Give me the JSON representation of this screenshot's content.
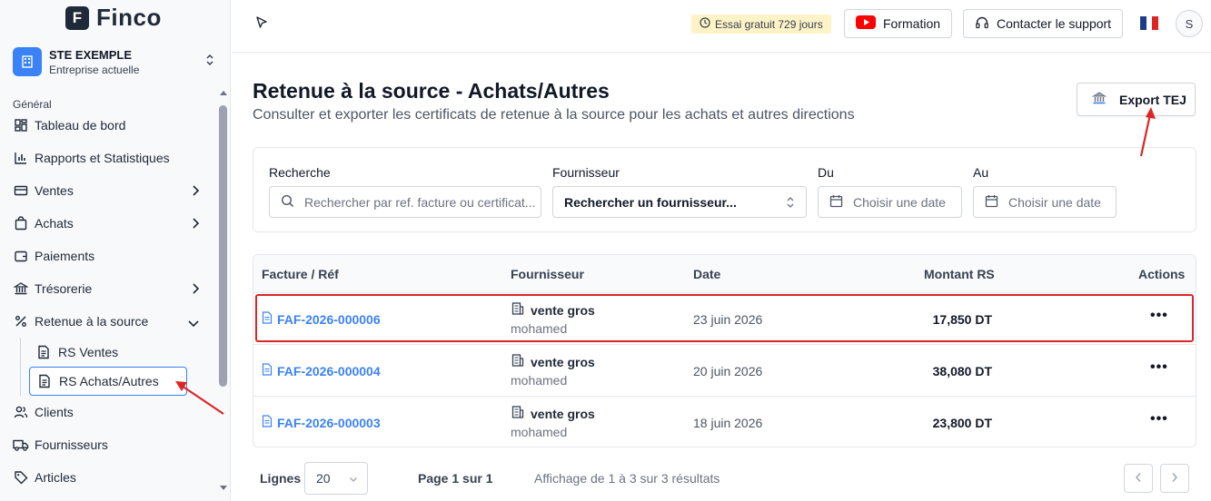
{
  "app": {
    "logo_letter": "F",
    "name": "Finco"
  },
  "company": {
    "name": "STE EXEMPLE",
    "subtitle": "Entreprise actuelle"
  },
  "sidebar": {
    "section_label": "Général",
    "items": [
      {
        "label": "Tableau de bord",
        "icon": "dashboard-icon"
      },
      {
        "label": "Rapports et Statistiques",
        "icon": "bar-chart-icon"
      },
      {
        "label": "Ventes",
        "icon": "card-icon",
        "chevron": "right"
      },
      {
        "label": "Achats",
        "icon": "shopping-bag-icon",
        "chevron": "right"
      },
      {
        "label": "Paiements",
        "icon": "wallet-icon"
      },
      {
        "label": "Trésorerie",
        "icon": "bank-icon",
        "chevron": "right"
      },
      {
        "label": "Retenue à la source",
        "icon": "percent-icon",
        "chevron": "down"
      }
    ],
    "sub_items": [
      {
        "label": "RS Ventes",
        "icon": "document-icon"
      },
      {
        "label": "RS Achats/Autres",
        "icon": "document-icon",
        "active": true
      }
    ],
    "items_after": [
      {
        "label": "Clients",
        "icon": "users-icon"
      },
      {
        "label": "Fournisseurs",
        "icon": "truck-icon"
      },
      {
        "label": "Articles",
        "icon": "tag-icon"
      }
    ]
  },
  "topbar": {
    "trial": "Essai gratuit 729 jours",
    "formation": "Formation",
    "support": "Contacter le support",
    "avatar": "S"
  },
  "page": {
    "title": "Retenue à la source - Achats/Autres",
    "subtitle": "Consulter et exporter les certificats de retenue à la source pour les achats et autres directions",
    "export_label": "Export TEJ"
  },
  "filters": {
    "search_label": "Recherche",
    "search_placeholder": "Rechercher par ref. facture ou certificat...",
    "supplier_label": "Fournisseur",
    "supplier_value": "Rechercher un fournisseur...",
    "from_label": "Du",
    "from_placeholder": "Choisir une date",
    "to_label": "Au",
    "to_placeholder": "Choisir une date"
  },
  "table": {
    "headers": [
      "Facture / Réf",
      "Fournisseur",
      "Date",
      "Montant RS",
      "Actions"
    ],
    "rows": [
      {
        "ref": "FAF-2026-000006",
        "supplier": "vente gros",
        "contact": "mohamed",
        "date": "23 juin 2026",
        "amount": "17,850 DT",
        "actions": "•••"
      },
      {
        "ref": "FAF-2026-000004",
        "supplier": "vente gros",
        "contact": "mohamed",
        "date": "20 juin 2026",
        "amount": "38,080 DT",
        "actions": "•••"
      },
      {
        "ref": "FAF-2026-000003",
        "supplier": "vente gros",
        "contact": "mohamed",
        "date": "18 juin 2026",
        "amount": "23,800 DT",
        "actions": "•••"
      }
    ]
  },
  "pagination": {
    "rows_label": "Lignes",
    "rows_value": "20",
    "page_text": "Page 1 sur 1",
    "info": "Affichage de 1 à 3 sur 3 résultats"
  },
  "colors": {
    "accent": "#3b82f6",
    "annotation": "#dc2626",
    "trial_bg": "#fef3c7"
  }
}
